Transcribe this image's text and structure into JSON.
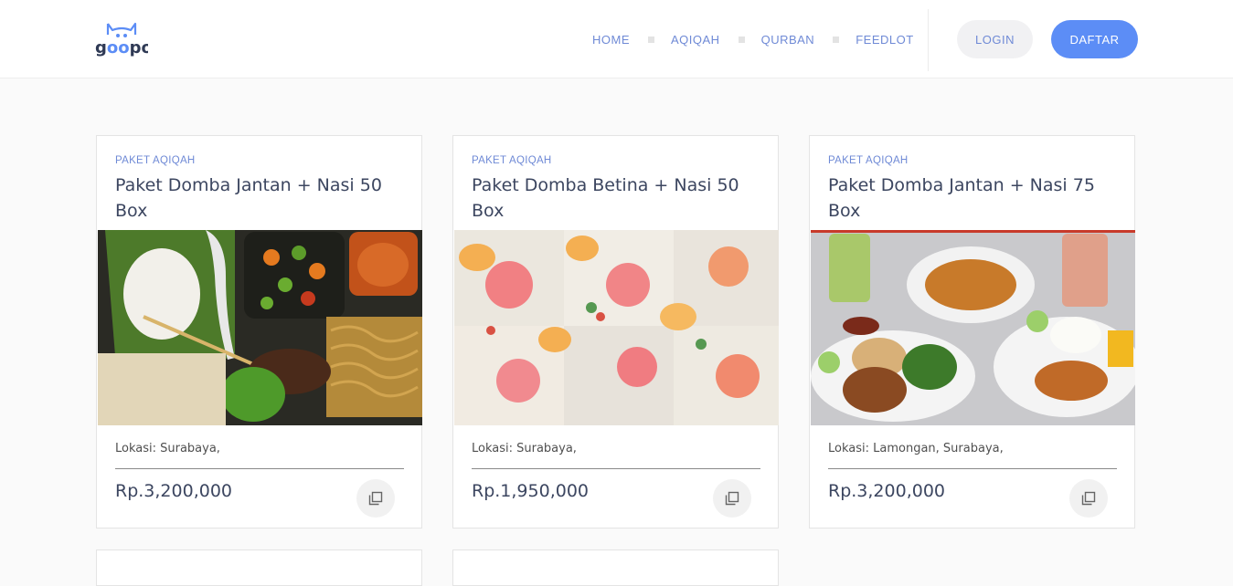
{
  "header": {
    "logo_text": "goopo",
    "nav": [
      "HOME",
      "AQIQAH",
      "QURBAN",
      "FEEDLOT"
    ],
    "login_label": "LOGIN",
    "register_label": "DAFTAR"
  },
  "colors": {
    "accent": "#5c8df6",
    "nav_text": "#6f8ad6",
    "title_text": "#3c4660"
  },
  "products": [
    {
      "category": "PAKET AQIQAH",
      "title": "Paket Domba Jantan + Nasi 50 Box",
      "location": "Lokasi: Surabaya,",
      "price": "Rp.3,200,000",
      "image": "nasi-box-photo"
    },
    {
      "category": "PAKET AQIQAH",
      "title": "Paket Domba Betina + Nasi 50 Box",
      "location": "Lokasi: Surabaya,",
      "price": "Rp.1,950,000",
      "image": "snack-boxes-photo"
    },
    {
      "category": "PAKET AQIQAH",
      "title": "Paket Domba Jantan + Nasi 75 Box",
      "location": "Lokasi: Lamongan, Surabaya,",
      "price": "Rp.3,200,000",
      "image": "plated-meals-photo"
    }
  ]
}
